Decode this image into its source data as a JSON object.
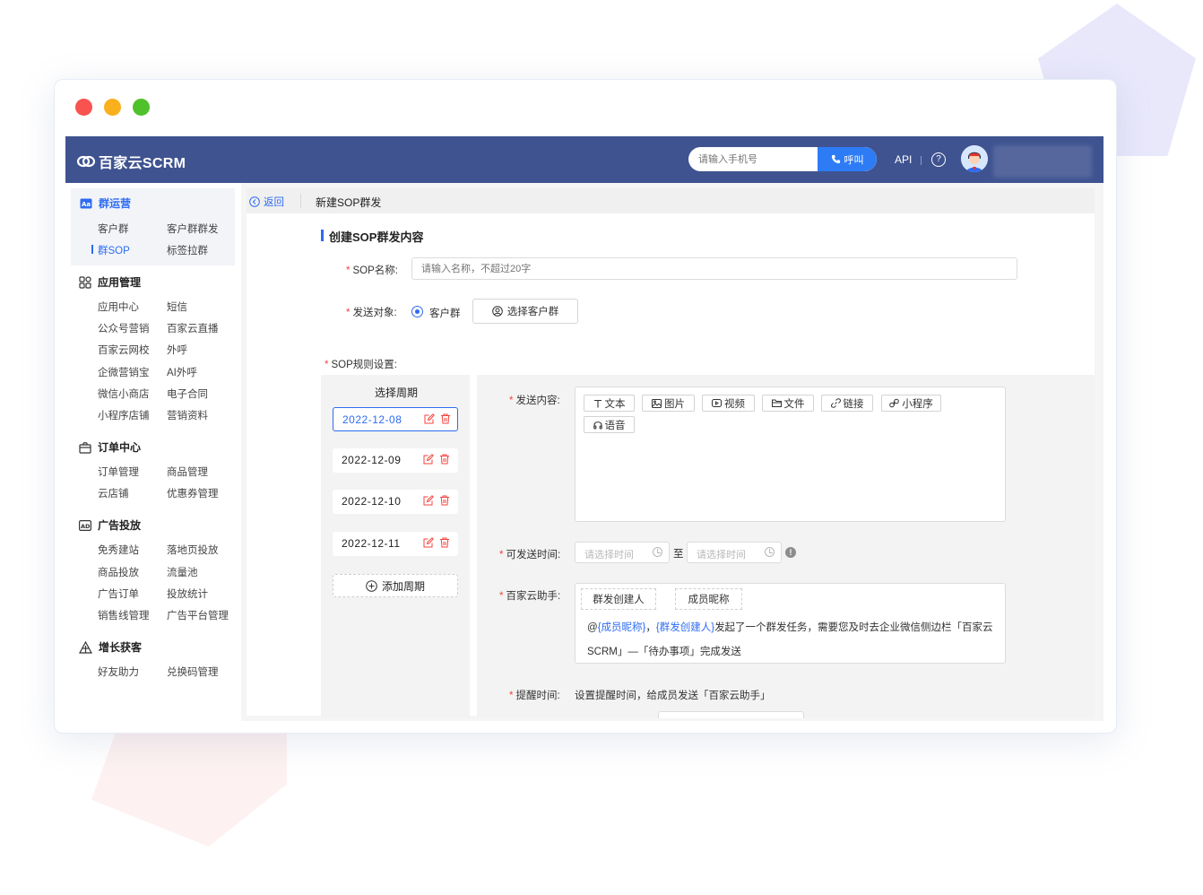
{
  "app": {
    "brand": "百家云SCRM",
    "phone_placeholder": "请输入手机号",
    "call_label": "呼叫",
    "api_label": "API",
    "help_label": "?"
  },
  "sidebar": {
    "sections": [
      {
        "title": "群运营",
        "items": [
          "客户群",
          "客户群群发",
          "群SOP",
          "标签拉群"
        ],
        "active_item": "群SOP"
      },
      {
        "title": "应用管理",
        "items": [
          "应用中心",
          "短信",
          "公众号营销",
          "百家云直播",
          "百家云网校",
          "外呼",
          "企微营销宝",
          "AI外呼",
          "微信小商店",
          "电子合同",
          "小程序店铺",
          "营销资料"
        ]
      },
      {
        "title": "订单中心",
        "items": [
          "订单管理",
          "商品管理",
          "云店铺",
          "优惠券管理"
        ]
      },
      {
        "title": "广告投放",
        "items": [
          "免秀建站",
          "落地页投放",
          "商品投放",
          "流量池",
          "广告订单",
          "投放统计",
          "销售线管理",
          "广告平台管理"
        ]
      },
      {
        "title": "增长获客",
        "items": [
          "好友助力",
          "兑换码管理"
        ]
      }
    ]
  },
  "header": {
    "back_label": "返回",
    "page_title": "新建SOP群发"
  },
  "form": {
    "section_title": "创建SOP群发内容",
    "required_mark": "*",
    "sop_name_label": "SOP名称:",
    "sop_name_placeholder": "请输入名称，不超过20字",
    "target_label": "发送对象:",
    "target_option": "客户群",
    "select_group_label": "选择客户群",
    "rules_label": "SOP规则设置:",
    "cycle_title": "选择周期",
    "cycles": [
      "2022-12-08",
      "2022-12-09",
      "2022-12-10",
      "2022-12-11"
    ],
    "add_cycle_label": "添加周期",
    "content_label": "发送内容:",
    "content_types": [
      "文本",
      "图片",
      "视频",
      "文件",
      "链接",
      "小程序",
      "语音"
    ],
    "send_time_label": "可发送时间:",
    "time_placeholder_start": "请选择时间",
    "time_separator": "至",
    "time_placeholder_end": "请选择时间",
    "info_label": "!",
    "assistant_label": "百家云助手:",
    "assistant_tags": [
      "群发创建人",
      "成员昵称"
    ],
    "assistant_text": {
      "prefix": "@",
      "var1": "{成员昵称}",
      "comma": "，",
      "var2": "{群发创建人}",
      "body": "发起了一个群发任务，需要您及时去企业微信侧边栏「百家云SCRM」—「待办事项」完成发送"
    },
    "remind_label": "提醒时间:",
    "remind_desc": "设置提醒时间，给成员发送「百家云助手」"
  },
  "colors": {
    "topbar": "#3f5390",
    "accent": "#2d6bf2",
    "required": "#f5433d",
    "delete": "#f5433d"
  }
}
